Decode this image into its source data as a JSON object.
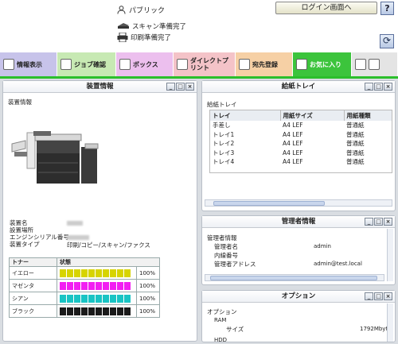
{
  "header": {
    "user_name": "パブリック",
    "login_button": "ログイン画面へ",
    "help_button": "?",
    "scan_status": "スキャン準備完了",
    "print_status": "印刷準備完了"
  },
  "tabs": [
    {
      "label": "情報表示",
      "color": "#c7c3ea"
    },
    {
      "label": "ジョブ確認",
      "color": "#c7e9b3"
    },
    {
      "label": "ボックス",
      "color": "#ecbfee"
    },
    {
      "label": "ダイレクトプリント",
      "color": "#f4c3c8"
    },
    {
      "label": "宛先登録",
      "color": "#f6d0a5"
    },
    {
      "label": "お気に入り",
      "color": "#3cc43c"
    }
  ],
  "device_panel": {
    "title": "装置情報",
    "section": "装置情報",
    "info_labels": [
      "装置名",
      "設置場所",
      "エンジンシリアル番号",
      "装置タイプ"
    ],
    "device_type": "印刷/コピー/スキャン/ファクス",
    "toner_header": [
      "トナー",
      "状態"
    ],
    "toners": [
      {
        "name": "イエロー",
        "color": "#d7d400",
        "pct": "100%"
      },
      {
        "name": "マゼンタ",
        "color": "#f21ef2",
        "pct": "100%"
      },
      {
        "name": "シアン",
        "color": "#19c4c4",
        "pct": "100%"
      },
      {
        "name": "ブラック",
        "color": "#1a1a1a",
        "pct": "100%"
      }
    ]
  },
  "paper_panel": {
    "title": "給紙トレイ",
    "section": "給紙トレイ",
    "columns": [
      "トレイ",
      "用紙サイズ",
      "用紙種類"
    ],
    "rows": [
      [
        "手差し",
        "A4 LEF",
        "普通紙"
      ],
      [
        "トレイ1",
        "A4 LEF",
        "普通紙"
      ],
      [
        "トレイ2",
        "A4 LEF",
        "普通紙"
      ],
      [
        "トレイ3",
        "A4 LEF",
        "普通紙"
      ],
      [
        "トレイ4",
        "A4 LEF",
        "普通紙"
      ]
    ]
  },
  "admin_panel": {
    "title": "管理者情報",
    "section": "管理者情報",
    "name_label": "管理者名",
    "name_value": "admin",
    "ext_label": "内線番号",
    "mail_label": "管理者アドレス",
    "mail_value": "admin@test.local"
  },
  "option_panel": {
    "title": "オプション",
    "section": "オプション",
    "ram_label": "RAM",
    "size_label": "サイズ",
    "size_value": "1792Mbyte",
    "hdd_label": "HDD"
  },
  "window_buttons": [
    "_",
    "□",
    "×"
  ]
}
